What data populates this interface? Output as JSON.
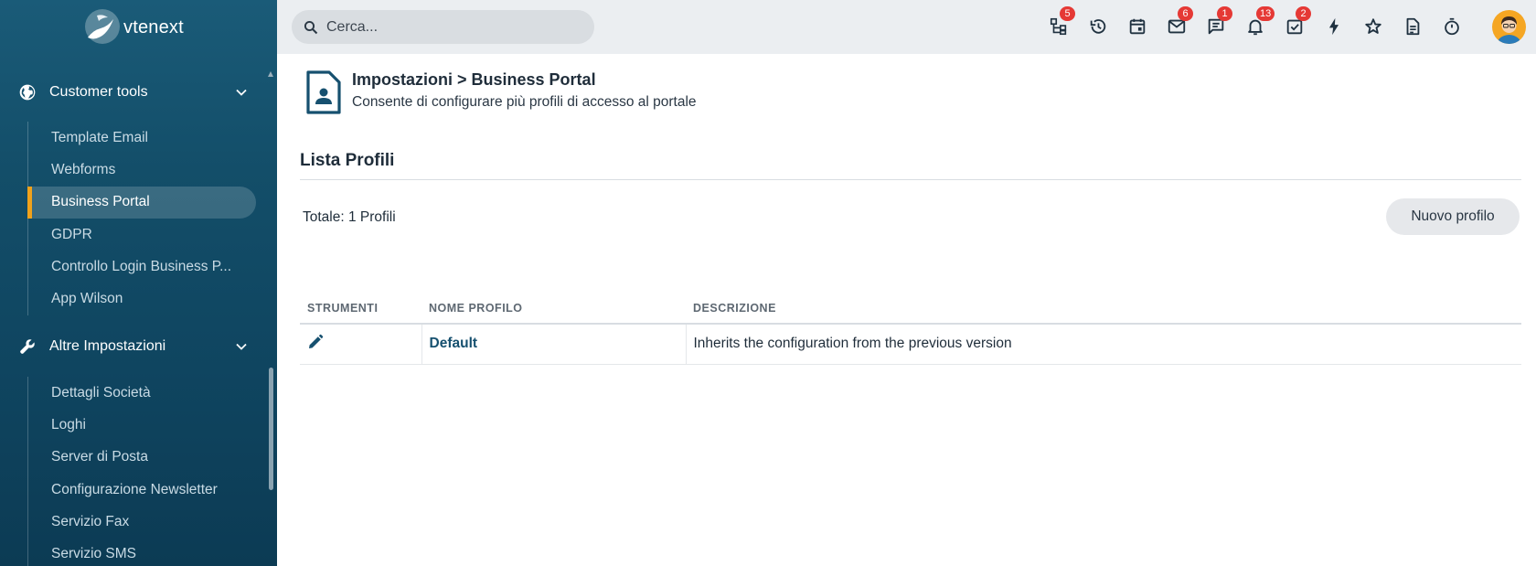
{
  "brand": {
    "logo_text": "vtenext"
  },
  "sidebar": {
    "sections": [
      {
        "label": "Customer tools",
        "icon": "globe-icon"
      },
      {
        "label": "Altre Impostazioni",
        "icon": "wrench-icon"
      }
    ],
    "customer_tools_items": [
      {
        "label": "Template Email"
      },
      {
        "label": "Webforms"
      },
      {
        "label": "Business Portal",
        "active": true
      },
      {
        "label": "GDPR"
      },
      {
        "label": "Controllo Login Business P..."
      },
      {
        "label": "App Wilson"
      }
    ],
    "altre_items": [
      {
        "label": "Dettagli Società"
      },
      {
        "label": "Loghi"
      },
      {
        "label": "Server di Posta"
      },
      {
        "label": "Configurazione Newsletter"
      },
      {
        "label": "Servizio Fax"
      },
      {
        "label": "Servizio SMS"
      }
    ]
  },
  "topbar": {
    "search_placeholder": "Cerca...",
    "icons": [
      {
        "name": "process-icon",
        "badge": "5"
      },
      {
        "name": "history-icon",
        "badge": ""
      },
      {
        "name": "calendar-icon",
        "badge": ""
      },
      {
        "name": "mail-icon",
        "badge": "6"
      },
      {
        "name": "chat-icon",
        "badge": "1"
      },
      {
        "name": "bell-icon",
        "badge": "13"
      },
      {
        "name": "tasks-icon",
        "badge": "2"
      },
      {
        "name": "lightning-icon",
        "badge": ""
      },
      {
        "name": "star-icon",
        "badge": ""
      },
      {
        "name": "document-icon",
        "badge": ""
      },
      {
        "name": "timer-icon",
        "badge": ""
      }
    ],
    "accent_badge_color": "#e53935"
  },
  "page": {
    "title": "Impostazioni > Business Portal",
    "subtitle": "Consente di configurare più profili di accesso al portale",
    "section_title": "Lista Profili",
    "total": "Totale: 1 Profili",
    "new_button": "Nuovo profilo"
  },
  "table": {
    "columns": [
      "STRUMENTI",
      "NOME PROFILO",
      "DESCRIZIONE"
    ],
    "rows": [
      {
        "name": "Default",
        "description": "Inherits the configuration from the previous version"
      }
    ]
  }
}
